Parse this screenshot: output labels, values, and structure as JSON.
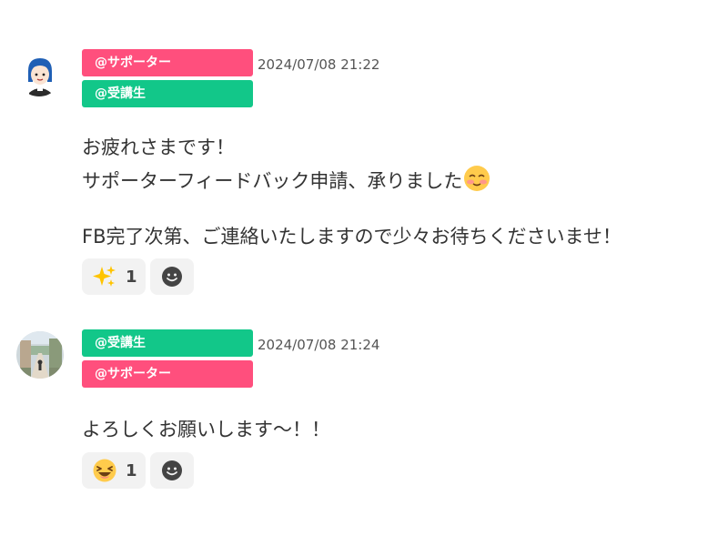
{
  "messages": [
    {
      "avatar": "supporter-avatar",
      "tags": [
        {
          "label": "@サポーター",
          "color": "#ff4f7d"
        },
        {
          "label": "@受講生",
          "color": "#12c789"
        }
      ],
      "timestamp": "2024/07/08 21:22",
      "lines": [
        "お疲れさまです！",
        "サポーターフィードバック申請、承りました",
        "FB完了次第、ご連絡いたしますので少々お待ちくださいませ！"
      ],
      "inline_emoji": "relieved-face-icon",
      "reaction": {
        "emoji": "sparkles-icon",
        "count": "1"
      },
      "add_reaction_icon": "smiley-add-icon"
    },
    {
      "avatar": "student-avatar",
      "tags": [
        {
          "label": "@受講生",
          "color": "#12c789"
        },
        {
          "label": "@サポーター",
          "color": "#ff4f7d"
        }
      ],
      "timestamp": "2024/07/08 21:24",
      "lines": [
        "よろしくお願いします〜！！"
      ],
      "reaction": {
        "emoji": "laughing-face-icon",
        "count": "1"
      },
      "add_reaction_icon": "smiley-add-icon"
    }
  ]
}
